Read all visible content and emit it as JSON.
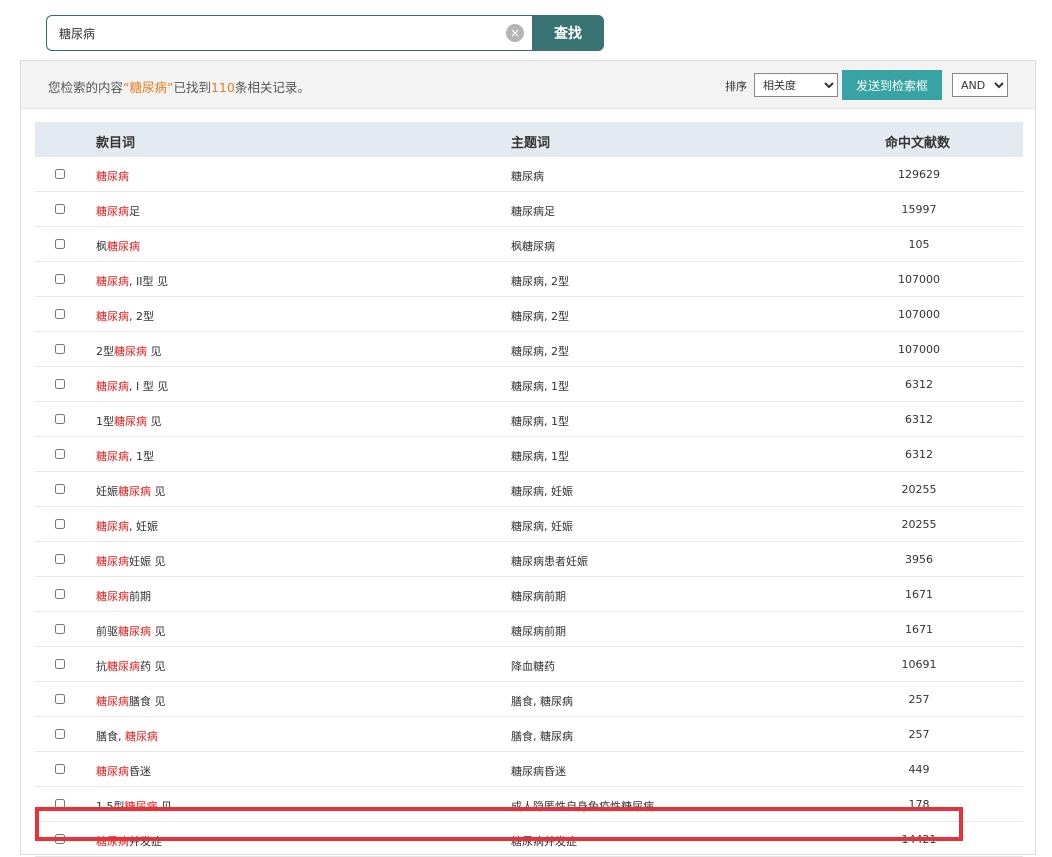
{
  "search": {
    "value": "糖尿病",
    "clear_icon": "×",
    "button_label": "查找"
  },
  "summary": {
    "prefix": "您检索的内容",
    "keyword": "“糖尿病”",
    "middle": "已找到",
    "count": "110",
    "suffix": "条相关记录。"
  },
  "toolbar": {
    "sort_label": "排序",
    "sort_value": "相关度",
    "send_label": "发送到检索框",
    "logic_value": "AND"
  },
  "table": {
    "headers": [
      "款目词",
      "主题词",
      "命中文献数"
    ],
    "rows": [
      {
        "pre": "",
        "hl": "糖尿病",
        "post": "",
        "subject": "糖尿病",
        "count": "129629"
      },
      {
        "pre": "",
        "hl": "糖尿病",
        "post": "足",
        "subject": "糖尿病足",
        "count": "15997"
      },
      {
        "pre": "枫",
        "hl": "糖尿病",
        "post": "",
        "subject": "枫糖尿病",
        "count": "105"
      },
      {
        "pre": "",
        "hl": "糖尿病",
        "post": ", II型 见",
        "subject": "糖尿病, 2型",
        "count": "107000"
      },
      {
        "pre": "",
        "hl": "糖尿病",
        "post": ", 2型",
        "subject": "糖尿病, 2型",
        "count": "107000"
      },
      {
        "pre": "2型",
        "hl": "糖尿病",
        "post": " 见",
        "subject": "糖尿病, 2型",
        "count": "107000"
      },
      {
        "pre": "",
        "hl": "糖尿病",
        "post": ", I 型 见",
        "subject": "糖尿病, 1型",
        "count": "6312"
      },
      {
        "pre": "1型",
        "hl": "糖尿病",
        "post": " 见",
        "subject": "糖尿病, 1型",
        "count": "6312"
      },
      {
        "pre": "",
        "hl": "糖尿病",
        "post": ", 1型",
        "subject": "糖尿病, 1型",
        "count": "6312"
      },
      {
        "pre": "妊娠",
        "hl": "糖尿病",
        "post": " 见",
        "subject": "糖尿病, 妊娠",
        "count": "20255"
      },
      {
        "pre": "",
        "hl": "糖尿病",
        "post": ", 妊娠",
        "subject": "糖尿病, 妊娠",
        "count": "20255"
      },
      {
        "pre": "",
        "hl": "糖尿病",
        "post": "妊娠 见",
        "subject": "糖尿病患者妊娠",
        "count": "3956"
      },
      {
        "pre": "",
        "hl": "糖尿病",
        "post": "前期",
        "subject": "糖尿病前期",
        "count": "1671"
      },
      {
        "pre": "前驱",
        "hl": "糖尿病",
        "post": " 见",
        "subject": "糖尿病前期",
        "count": "1671"
      },
      {
        "pre": "抗",
        "hl": "糖尿病",
        "post": "药 见",
        "subject": "降血糖药",
        "count": "10691"
      },
      {
        "pre": "",
        "hl": "糖尿病",
        "post": "膳食 见",
        "subject": "膳食, 糖尿病",
        "count": "257"
      },
      {
        "pre": "膳食, ",
        "hl": "糖尿病",
        "post": "",
        "subject": "膳食, 糖尿病",
        "count": "257"
      },
      {
        "pre": "",
        "hl": "糖尿病",
        "post": "昏迷",
        "subject": "糖尿病昏迷",
        "count": "449"
      },
      {
        "pre": "1.5型",
        "hl": "糖尿病",
        "post": " 见",
        "subject": "成人隐匿性自身免疫性糖尿病",
        "count": "178"
      },
      {
        "pre": "",
        "hl": "糖尿病",
        "post": "并发症",
        "subject": "糖尿病并发症",
        "count": "14421"
      }
    ]
  }
}
